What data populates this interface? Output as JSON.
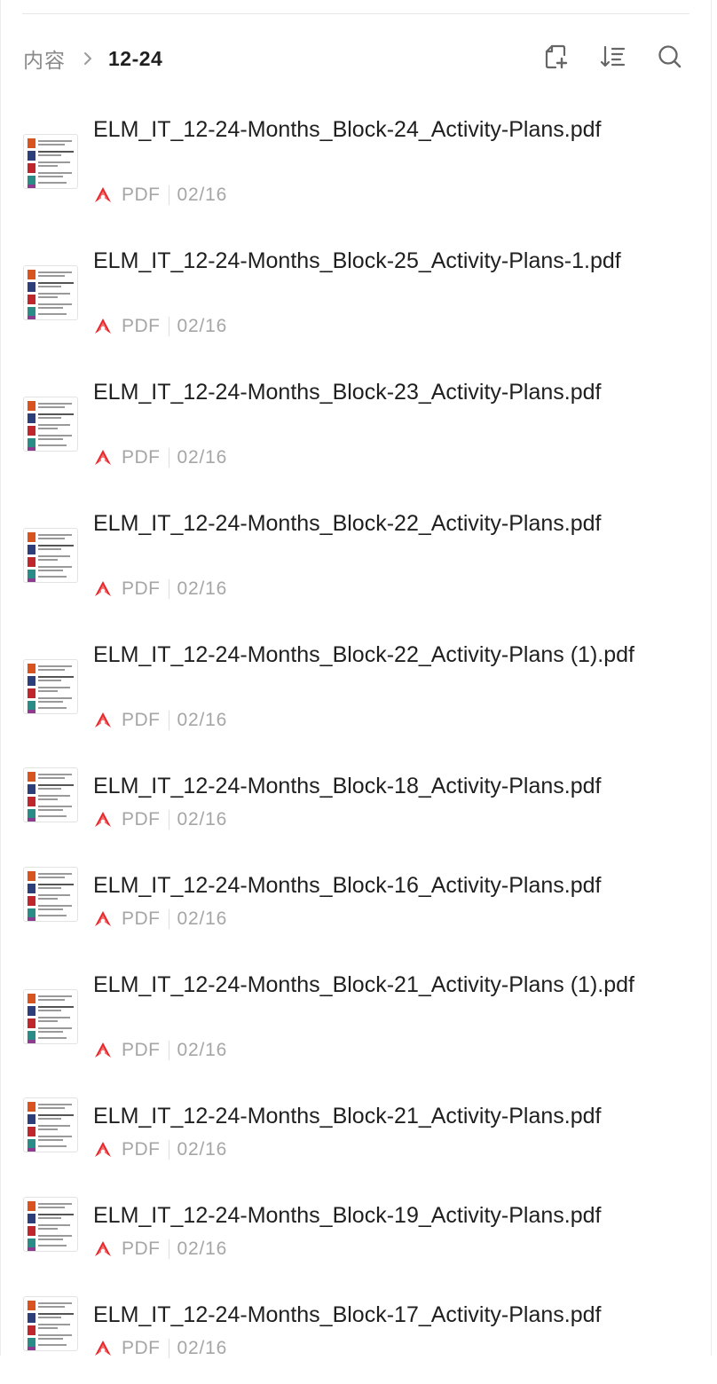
{
  "breadcrumb": {
    "root": "内容",
    "current": "12-24"
  },
  "toolbar": {
    "icons": [
      "new-file-icon",
      "sort-icon",
      "search-icon"
    ]
  },
  "colors": {
    "pdf_red": "#e8262a",
    "meta_gray": "#a6a6a6",
    "text": "#1f1f1f"
  },
  "files": [
    {
      "name": "ELM_IT_12-24-Months_Block-24_Activity-Plans.pdf",
      "type": "PDF",
      "date": "02/16"
    },
    {
      "name": "ELM_IT_12-24-Months_Block-25_Activity-Plans-1.pdf",
      "type": "PDF",
      "date": "02/16"
    },
    {
      "name": "ELM_IT_12-24-Months_Block-23_Activity-Plans.pdf",
      "type": "PDF",
      "date": "02/16"
    },
    {
      "name": "ELM_IT_12-24-Months_Block-22_Activity-Plans.pdf",
      "type": "PDF",
      "date": "02/16"
    },
    {
      "name": "ELM_IT_12-24-Months_Block-22_Activity-Plans (1).pdf",
      "type": "PDF",
      "date": "02/16"
    },
    {
      "name": "ELM_IT_12-24-Months_Block-18_Activity-Plans.pdf",
      "type": "PDF",
      "date": "02/16"
    },
    {
      "name": "ELM_IT_12-24-Months_Block-16_Activity-Plans.pdf",
      "type": "PDF",
      "date": "02/16"
    },
    {
      "name": "ELM_IT_12-24-Months_Block-21_Activity-Plans (1).pdf",
      "type": "PDF",
      "date": "02/16"
    },
    {
      "name": "ELM_IT_12-24-Months_Block-21_Activity-Plans.pdf",
      "type": "PDF",
      "date": "02/16"
    },
    {
      "name": "ELM_IT_12-24-Months_Block-19_Activity-Plans.pdf",
      "type": "PDF",
      "date": "02/16"
    },
    {
      "name": "ELM_IT_12-24-Months_Block-17_Activity-Plans.pdf",
      "type": "PDF",
      "date": "02/16"
    }
  ]
}
